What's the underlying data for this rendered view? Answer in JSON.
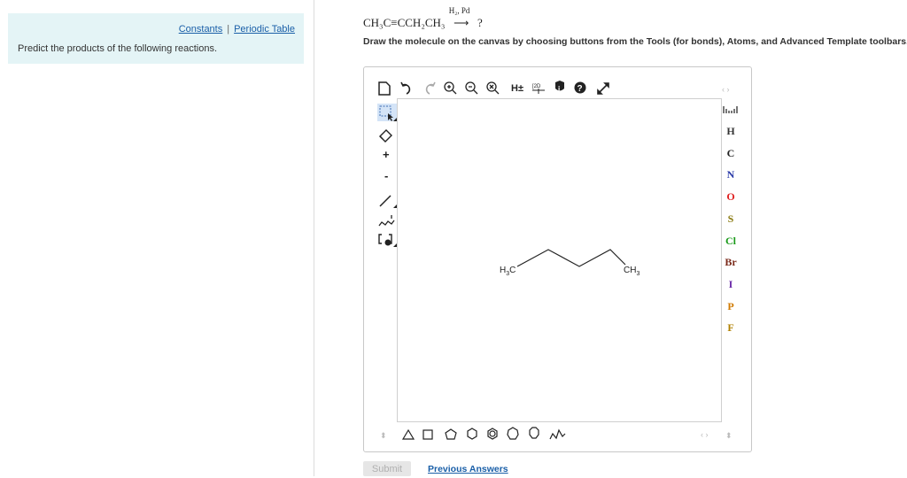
{
  "left_panel": {
    "links": {
      "constants": "Constants",
      "separator": "|",
      "periodic_table": "Periodic Table"
    },
    "prompt": "Predict the products of the following reactions."
  },
  "equation": {
    "reactant": "CH₃C≡CCH₂CH₃",
    "reagent": "H₂, Pd",
    "product": "?"
  },
  "instructions": "Draw the molecule on the canvas by choosing buttons from the Tools (for bonds), Atoms, and Advanced Template toolbars. The single bond is active by default.",
  "toolbar": {
    "top": [
      "new-document",
      "undo",
      "redo",
      "zoom-in",
      "zoom-out",
      "zoom-reset",
      "hydrogens",
      "2d-clean",
      "info",
      "help",
      "fullscreen"
    ],
    "hydrogens_label": "H±",
    "clean_label": "[2D",
    "left": [
      "select",
      "erase",
      "charge-plus",
      "charge-minus",
      "single-bond",
      "chain",
      "template"
    ],
    "plus_label": "+",
    "minus_label": "-"
  },
  "atoms": [
    {
      "symbol": "H",
      "color": "#333333"
    },
    {
      "symbol": "C",
      "color": "#222222"
    },
    {
      "symbol": "N",
      "color": "#2a3aa8"
    },
    {
      "symbol": "O",
      "color": "#e02020"
    },
    {
      "symbol": "S",
      "color": "#8a7a10"
    },
    {
      "symbol": "Cl",
      "color": "#1a9a1a"
    },
    {
      "symbol": "Br",
      "color": "#7a2a1a"
    },
    {
      "symbol": "I",
      "color": "#6a2aa8"
    },
    {
      "symbol": "P",
      "color": "#d07a00"
    },
    {
      "symbol": "F",
      "color": "#b08000"
    }
  ],
  "molecule": {
    "left_label": "H3C",
    "right_label": "CH3"
  },
  "bottom_templates": [
    "triangle",
    "square",
    "pentagon",
    "hexagon",
    "hexagon-aromatic",
    "heptagon",
    "octagon",
    "chair"
  ],
  "buttons": {
    "submit": "Submit",
    "previous_answers": "Previous Answers"
  }
}
